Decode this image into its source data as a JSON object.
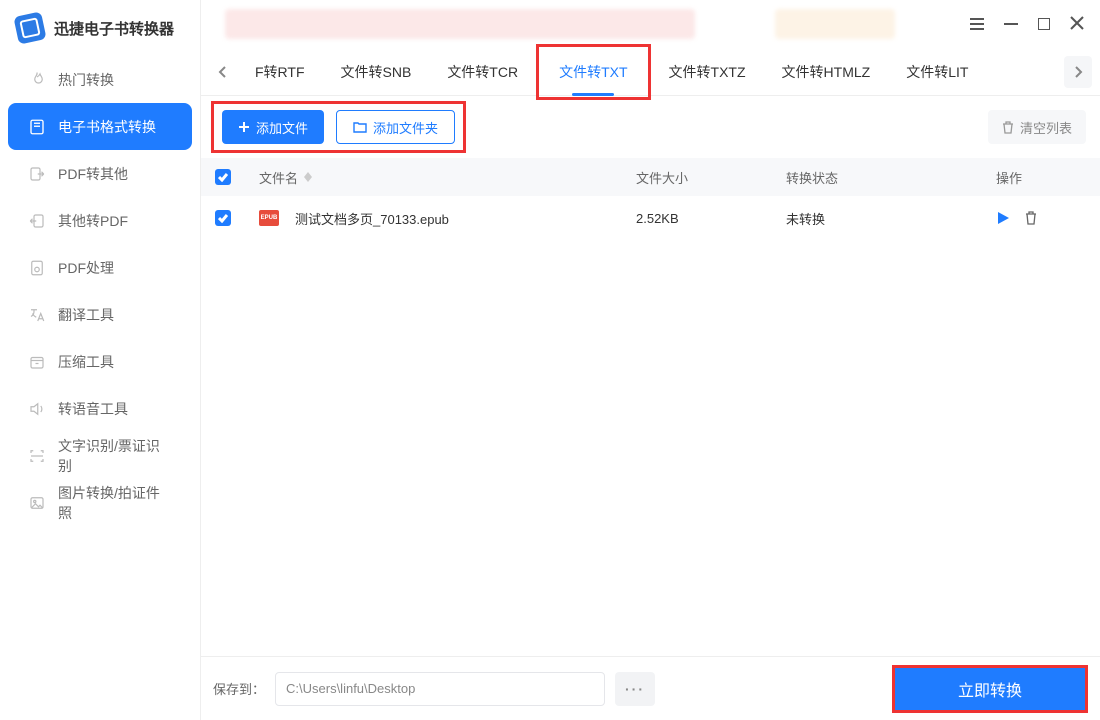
{
  "app": {
    "title": "迅捷电子书转换器"
  },
  "sidebar": {
    "items": [
      {
        "id": "hot",
        "label": "热门转换"
      },
      {
        "id": "ebook",
        "label": "电子书格式转换"
      },
      {
        "id": "pdf2",
        "label": "PDF转其他"
      },
      {
        "id": "topdf",
        "label": "其他转PDF"
      },
      {
        "id": "pdfop",
        "label": "PDF处理"
      },
      {
        "id": "trans",
        "label": "翻译工具"
      },
      {
        "id": "zip",
        "label": "压缩工具"
      },
      {
        "id": "tts",
        "label": "转语音工具"
      },
      {
        "id": "ocr",
        "label": "文字识别/票证识别"
      },
      {
        "id": "img",
        "label": "图片转换/拍证件照"
      }
    ],
    "active_index": 1
  },
  "tabs": {
    "items": [
      {
        "label": "F转RTF"
      },
      {
        "label": "文件转SNB"
      },
      {
        "label": "文件转TCR"
      },
      {
        "label": "文件转TXT"
      },
      {
        "label": "文件转TXTZ"
      },
      {
        "label": "文件转HTMLZ"
      },
      {
        "label": "文件转LIT"
      }
    ],
    "active_index": 3
  },
  "toolbar": {
    "add_file": "添加文件",
    "add_folder": "添加文件夹",
    "clear_list": "清空列表"
  },
  "table": {
    "headers": {
      "name": "文件名",
      "size": "文件大小",
      "status": "转换状态",
      "ops": "操作"
    },
    "rows": [
      {
        "checked": true,
        "name": "测试文档多页_70133.epub",
        "size": "2.52KB",
        "status": "未转换"
      }
    ]
  },
  "bottom": {
    "save_label": "保存到：",
    "path": "C:\\Users\\linfu\\Desktop",
    "browse": "···",
    "convert": "立即转换"
  }
}
